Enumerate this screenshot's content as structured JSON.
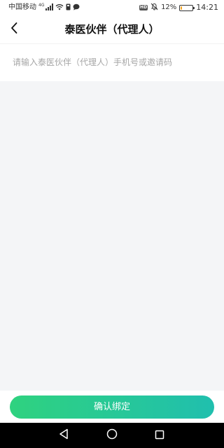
{
  "status_bar": {
    "carrier": "中国移动",
    "network_label": "4G",
    "hd_label": "HD",
    "battery_percent": "12%",
    "battery_level": 0.12,
    "time": "14:21"
  },
  "header": {
    "back_icon": "back-arrow-icon",
    "title": "泰医伙伴（代理人）"
  },
  "form": {
    "input_value": "",
    "input_placeholder": "请输入泰医伙伴（代理人）手机号或邀请码"
  },
  "footer": {
    "confirm_label": "确认绑定"
  },
  "colors": {
    "button_gradient_start": "#2fd27f",
    "button_gradient_end": "#20bfae",
    "content_background": "#f4f5f7",
    "battery_fill": "#f5a623"
  },
  "android_nav": {
    "back_icon": "triangle-back-icon",
    "home_icon": "circle-home-icon",
    "recents_icon": "square-recents-icon"
  }
}
